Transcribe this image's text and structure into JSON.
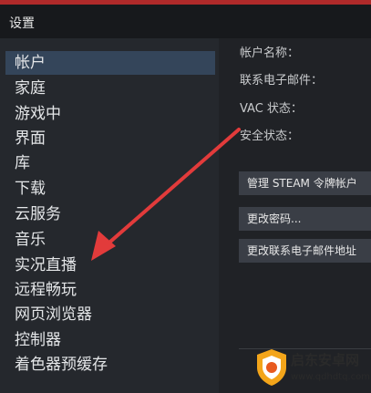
{
  "window": {
    "title": "设置"
  },
  "sidebar": {
    "items": [
      {
        "label": "帐户",
        "active": true
      },
      {
        "label": "家庭"
      },
      {
        "label": "游戏中"
      },
      {
        "label": "界面"
      },
      {
        "label": "库"
      },
      {
        "label": "下载"
      },
      {
        "label": "云服务"
      },
      {
        "label": "音乐"
      },
      {
        "label": "实况直播"
      },
      {
        "label": "远程畅玩"
      },
      {
        "label": "网页浏览器"
      },
      {
        "label": "控制器"
      },
      {
        "label": "着色器预缓存"
      }
    ]
  },
  "account": {
    "name_label": "帐户名称：",
    "email_label": "联系电子邮件：",
    "vac_label": "VAC 状态：",
    "security_label": "安全状态：",
    "buttons": {
      "steam_guard": "管理 STEAM 令牌帐户",
      "change_password": "更改密码...",
      "change_email": "更改联系电子邮件地址"
    }
  },
  "watermark": {
    "name": "启东安卓网",
    "url": "www.qdhdtq.com"
  },
  "colors": {
    "accent_active": "#34455a",
    "arrow": "#e23b3b",
    "top_strip": "#b02a2a"
  }
}
